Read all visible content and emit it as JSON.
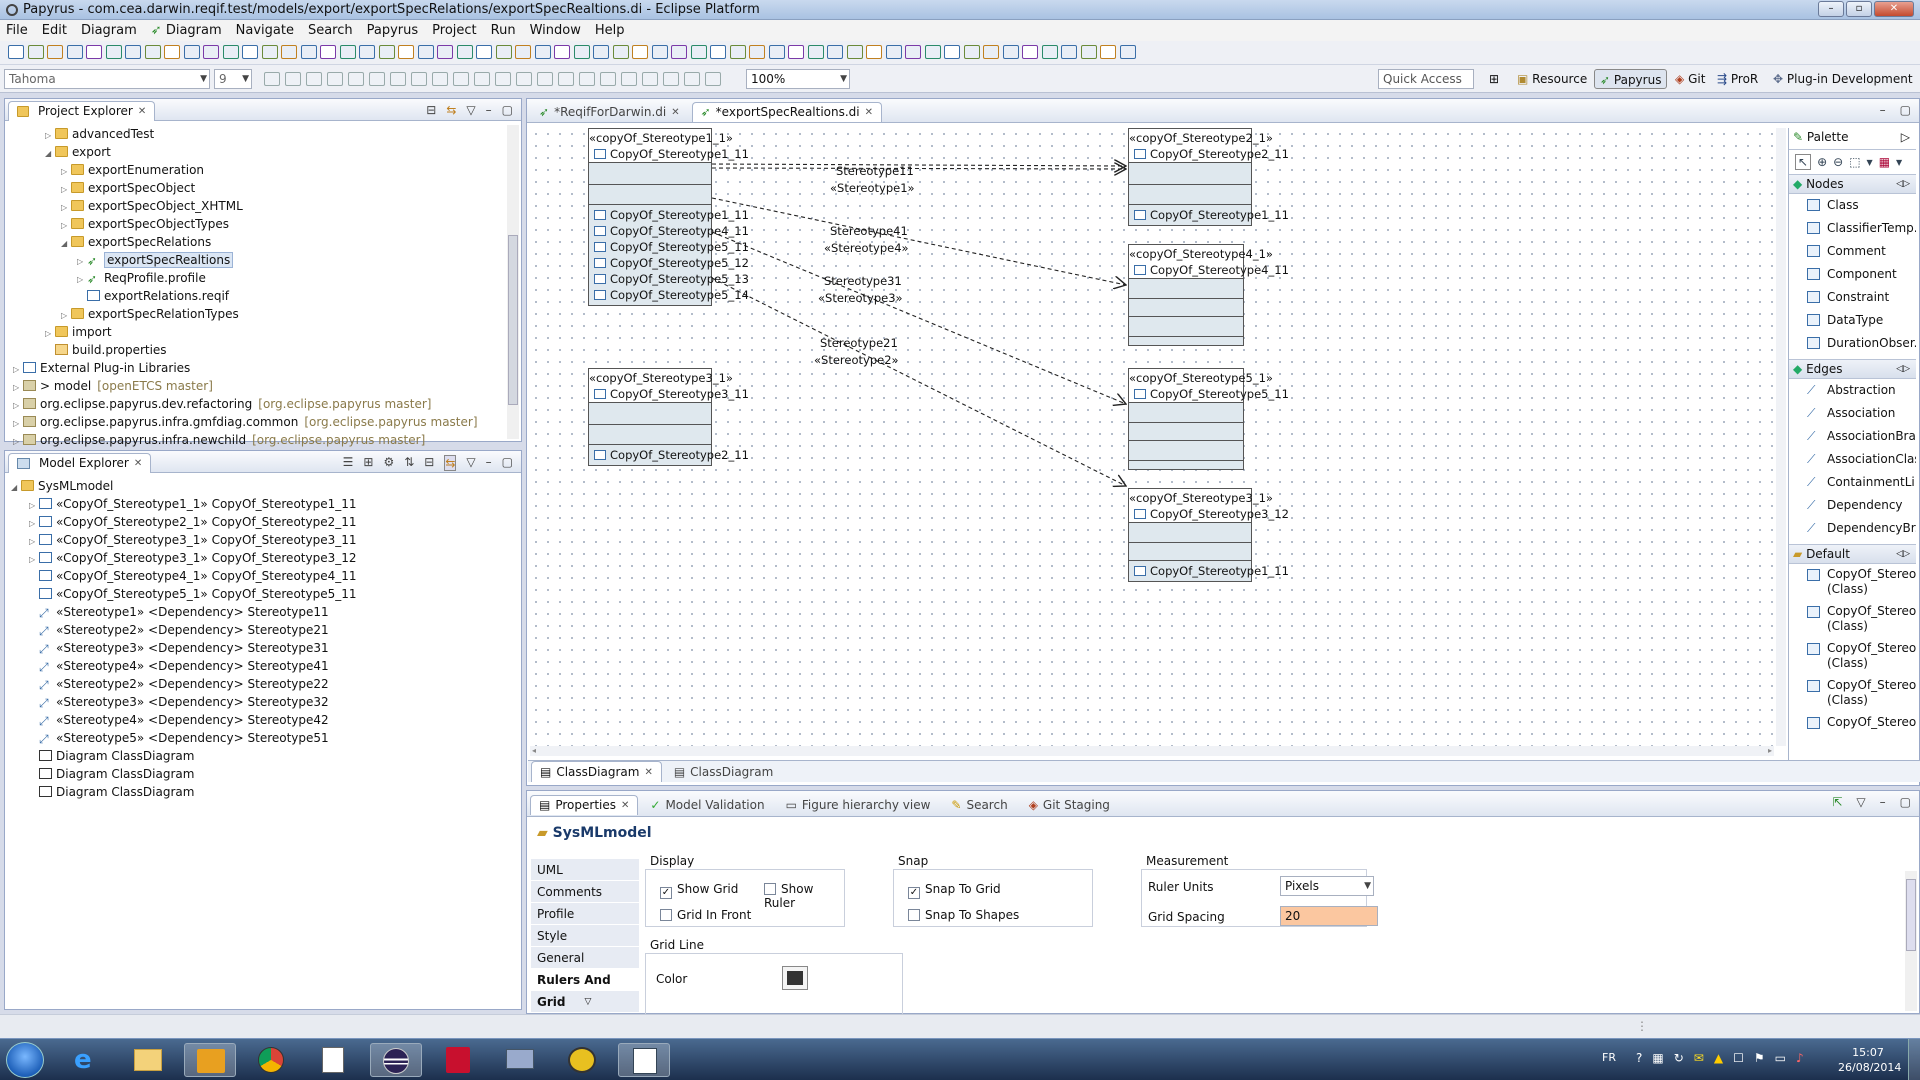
{
  "window": {
    "title": "Papyrus - com.cea.darwin.reqif.test/models/export/exportSpecRelations/exportSpecRealtions.di - Eclipse Platform"
  },
  "menu": [
    "File",
    "Edit",
    "Diagram",
    "Diagram",
    "Navigate",
    "Search",
    "Papyrus",
    "Project",
    "Run",
    "Window",
    "Help"
  ],
  "toolbar": {
    "font": "Tahoma",
    "size": "9",
    "zoom": "100%",
    "quick_access": "Quick Access",
    "perspectives": [
      "Resource",
      "Papyrus",
      "Git",
      "ProR",
      "Plug-in Development"
    ]
  },
  "project_explorer": {
    "title": "Project Explorer",
    "items": [
      {
        "label": "advancedTest",
        "indent": 3,
        "type": "folder"
      },
      {
        "label": "export",
        "indent": 3,
        "type": "folder",
        "expanded": true
      },
      {
        "label": "exportEnumeration",
        "indent": 4,
        "type": "folder"
      },
      {
        "label": "exportSpecObject",
        "indent": 4,
        "type": "folder"
      },
      {
        "label": "exportSpecObject_XHTML",
        "indent": 4,
        "type": "folder"
      },
      {
        "label": "exportSpecObjectTypes",
        "indent": 4,
        "type": "folder"
      },
      {
        "label": "exportSpecRelations",
        "indent": 4,
        "type": "folder",
        "expanded": true
      },
      {
        "label": "exportSpecRealtions",
        "indent": 5,
        "type": "papyrus",
        "selected": true
      },
      {
        "label": "ReqProfile.profile",
        "indent": 5,
        "type": "papyrus"
      },
      {
        "label": "exportRelations.reqif",
        "indent": 5,
        "type": "reqif"
      },
      {
        "label": "exportSpecRelationTypes",
        "indent": 4,
        "type": "folder"
      },
      {
        "label": "import",
        "indent": 3,
        "type": "folder"
      },
      {
        "label": "build.properties",
        "indent": 3,
        "type": "file"
      },
      {
        "label": "External Plug-in Libraries",
        "indent": 1,
        "type": "lib"
      },
      {
        "label": "> model",
        "deco": "[openETCS master]",
        "indent": 1,
        "type": "proj"
      },
      {
        "label": "org.eclipse.papyrus.dev.refactoring",
        "deco": "[org.eclipse.papyrus master]",
        "indent": 1,
        "type": "proj"
      },
      {
        "label": "org.eclipse.papyrus.infra.gmfdiag.common",
        "deco": "[org.eclipse.papyrus master]",
        "indent": 1,
        "type": "proj"
      },
      {
        "label": "org.eclipse.papyrus.infra.newchild",
        "deco": "[org.eclipse.papyrus master]",
        "indent": 1,
        "type": "proj"
      }
    ]
  },
  "model_explorer": {
    "title": "Model Explorer",
    "root": "SysMLmodel",
    "items": [
      {
        "label": "«CopyOf_Stereotype1_1» CopyOf_Stereotype1_11",
        "type": "cls"
      },
      {
        "label": "«CopyOf_Stereotype2_1» CopyOf_Stereotype2_11",
        "type": "cls"
      },
      {
        "label": "«CopyOf_Stereotype3_1» CopyOf_Stereotype3_11",
        "type": "cls"
      },
      {
        "label": "«CopyOf_Stereotype3_1» CopyOf_Stereotype3_12",
        "type": "cls"
      },
      {
        "label": "«CopyOf_Stereotype4_1» CopyOf_Stereotype4_11",
        "type": "cls"
      },
      {
        "label": "«CopyOf_Stereotype5_1» CopyOf_Stereotype5_11",
        "type": "cls"
      },
      {
        "label": "«Stereotype1» <Dependency> Stereotype11",
        "type": "dep"
      },
      {
        "label": "«Stereotype2» <Dependency> Stereotype21",
        "type": "dep"
      },
      {
        "label": "«Stereotype3» <Dependency> Stereotype31",
        "type": "dep"
      },
      {
        "label": "«Stereotype4» <Dependency> Stereotype41",
        "type": "dep"
      },
      {
        "label": "«Stereotype2» <Dependency> Stereotype22",
        "type": "dep"
      },
      {
        "label": "«Stereotype3» <Dependency> Stereotype32",
        "type": "dep"
      },
      {
        "label": "«Stereotype4» <Dependency> Stereotype42",
        "type": "dep"
      },
      {
        "label": "«Stereotype5» <Dependency> Stereotype51",
        "type": "dep"
      },
      {
        "label": "Diagram ClassDiagram",
        "type": "diag"
      },
      {
        "label": "Diagram ClassDiagram",
        "type": "diag"
      },
      {
        "label": "Diagram ClassDiagram",
        "type": "diag"
      }
    ]
  },
  "editor_tabs": [
    "*ReqifForDarwin.di",
    "*exportSpecRealtions.di"
  ],
  "diagram": {
    "boxes": [
      {
        "stereo": "«copyOf_Stereotype1_1»",
        "name": "CopyOf_Stereotype1_11",
        "attrs": [
          "CopyOf_Stereotype1_11",
          "CopyOf_Stereotype4_11",
          "CopyOf_Stereotype5_11",
          "CopyOf_Stereotype5_12",
          "CopyOf_Stereotype5_13",
          "CopyOf_Stereotype5_14"
        ]
      },
      {
        "stereo": "«copyOf_Stereotype3_1»",
        "name": "CopyOf_Stereotype3_11",
        "attrs": [
          "CopyOf_Stereotype2_11"
        ]
      },
      {
        "stereo": "«copyOf_Stereotype2_1»",
        "name": "CopyOf_Stereotype2_11",
        "attrs": [
          "CopyOf_Stereotype1_11"
        ]
      },
      {
        "stereo": "«copyOf_Stereotype4_1»",
        "name": "CopyOf_Stereotype4_11",
        "attrs": []
      },
      {
        "stereo": "«copyOf_Stereotype5_1»",
        "name": "CopyOf_Stereotype5_11",
        "attrs": []
      },
      {
        "stereo": "«copyOf_Stereotype3_1»",
        "name": "CopyOf_Stereotype3_12",
        "attrs": [
          "CopyOf_Stereotype1_11"
        ]
      }
    ],
    "edges": [
      {
        "name": "Stereotype11",
        "stereo": "«Stereotype1»"
      },
      {
        "name": "Stereotype41",
        "stereo": "«Stereotype4»"
      },
      {
        "name": "Stereotype31",
        "stereo": "«Stereotype3»"
      },
      {
        "name": "Stereotype21",
        "stereo": "«Stereotype2»"
      }
    ]
  },
  "palette": {
    "title": "Palette",
    "nodes_title": "Nodes",
    "nodes": [
      "Class",
      "ClassifierTemp...",
      "Comment",
      "Component",
      "Constraint",
      "DataType",
      "DurationObser..."
    ],
    "edges_title": "Edges",
    "edges": [
      "Abstraction",
      "Association",
      "AssociationBra...",
      "AssociationClass",
      "ContainmentLi...",
      "Dependency",
      "DependencyBr..."
    ],
    "default_title": "Default",
    "default": [
      {
        "a": "CopyOf_Stereo...",
        "b": "(Class)"
      },
      {
        "a": "CopyOf_Stereo...",
        "b": "(Class)"
      },
      {
        "a": "CopyOf_Stereo...",
        "b": "(Class)"
      },
      {
        "a": "CopyOf_Stereo...",
        "b": "(Class)"
      },
      {
        "a": "CopyOf_Stereo...",
        "b": ""
      }
    ]
  },
  "diagram_tabs": [
    "ClassDiagram",
    "ClassDiagram"
  ],
  "bottom_tabs": [
    "Properties",
    "Model Validation",
    "Figure hierarchy view",
    "Search",
    "Git Staging"
  ],
  "properties": {
    "title": "SysMLmodel",
    "tabs": [
      "UML",
      "Comments",
      "Profile",
      "Style",
      "General",
      "Rulers And Grid"
    ],
    "display": {
      "label": "Display",
      "show_grid": "Show Grid",
      "show_ruler": "Show Ruler",
      "grid_front": "Grid In Front"
    },
    "snap": {
      "label": "Snap",
      "snap_grid": "Snap To Grid",
      "snap_shapes": "Snap To Shapes"
    },
    "measurement": {
      "label": "Measurement",
      "ruler_units": "Ruler Units",
      "ruler_value": "Pixels",
      "grid_spacing": "Grid Spacing",
      "grid_value": "20"
    },
    "gridline": {
      "label": "Grid Line",
      "color": "Color"
    }
  },
  "tray": {
    "lang": "FR",
    "time": "15:07",
    "date": "26/08/2014"
  }
}
